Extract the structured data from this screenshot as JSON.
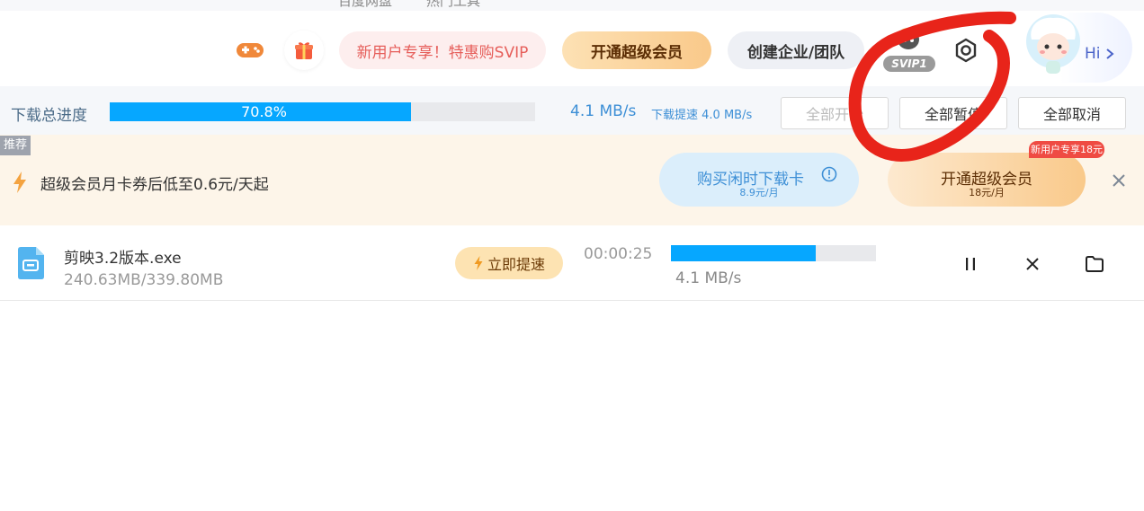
{
  "top_strip": {
    "left_text": "百度网盘",
    "right_text": "热门工具"
  },
  "header": {
    "promo_pill": "新用户专享！特惠购SVIP",
    "open_svip_button": "开通超级会员",
    "create_team_button": "创建企业/团队",
    "svip_badge": "SVIP1",
    "greeting": "Hi",
    "icons": [
      "game-controller-icon",
      "gift-icon",
      "settings-icon",
      "avatar"
    ]
  },
  "progress_bar": {
    "label": "下载总进度",
    "percent_text": "70.8%",
    "percent_value": 70.8,
    "speed": "4.1 MB/s",
    "boost_speed": "下载提速 4.0 MB/s",
    "start_all": "全部开始",
    "pause_all": "全部暂停",
    "cancel_all": "全部取消"
  },
  "banner": {
    "tag": "推荐",
    "text": "超级会员月卡券后低至0.6元/天起",
    "idle_card_title": "购买闲时下载卡",
    "idle_card_price": "8.9元/月",
    "svip_title": "开通超级会员",
    "svip_price": "18元/月",
    "new_user_tag": "新用户专享18元"
  },
  "download": {
    "filename": "剪映3.2版本.exe",
    "size": "240.63MB/339.80MB",
    "boost_button": "立即提速",
    "time_left": "00:00:25",
    "progress_value": 70.8,
    "speed": "4.1 MB/s"
  },
  "colors": {
    "accent_blue": "#06a7ff",
    "annotation_red": "#e8241a",
    "banner_bg": "#fdf5e9",
    "gold": "#f8c97d"
  }
}
